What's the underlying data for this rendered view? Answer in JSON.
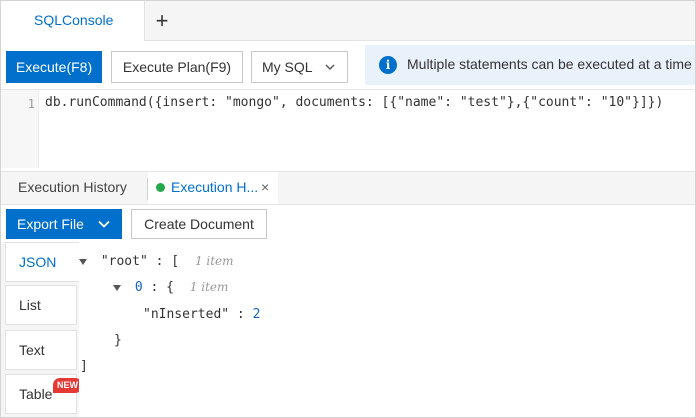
{
  "tabs": {
    "active_label": "SQLConsole",
    "add_label": "+"
  },
  "toolbar": {
    "execute_label": "Execute(F8)",
    "plan_label": "Execute Plan(F9)",
    "db_type": "My SQL",
    "info_text": "Multiple statements can be executed at a time"
  },
  "editor": {
    "line_number": "1",
    "code": "db.runCommand({insert: \"mongo\", documents: [{\"name\": \"test\"},{\"count\": \"10\"}]})"
  },
  "result_tabs": {
    "history_label": "Execution History",
    "active_label": "Execution H...",
    "close_label": "×"
  },
  "result_toolbar": {
    "export_label": "Export File",
    "create_label": "Create Document"
  },
  "views": {
    "json": "JSON",
    "list": "List",
    "text": "Text",
    "table": "Table",
    "new_badge": "NEW"
  },
  "tree": {
    "root_key": "\"root\"",
    "root_open": ": [",
    "root_hint": "1 item",
    "item_index": "0",
    "item_open": ": {",
    "item_hint": "1 item",
    "field_key": "\"nInserted\"",
    "field_sep": ":",
    "field_value": "2",
    "item_close": "}",
    "root_close": "]"
  },
  "colors": {
    "accent": "#0070cc",
    "success_dot": "#23a84c",
    "badge": "#e53935"
  }
}
